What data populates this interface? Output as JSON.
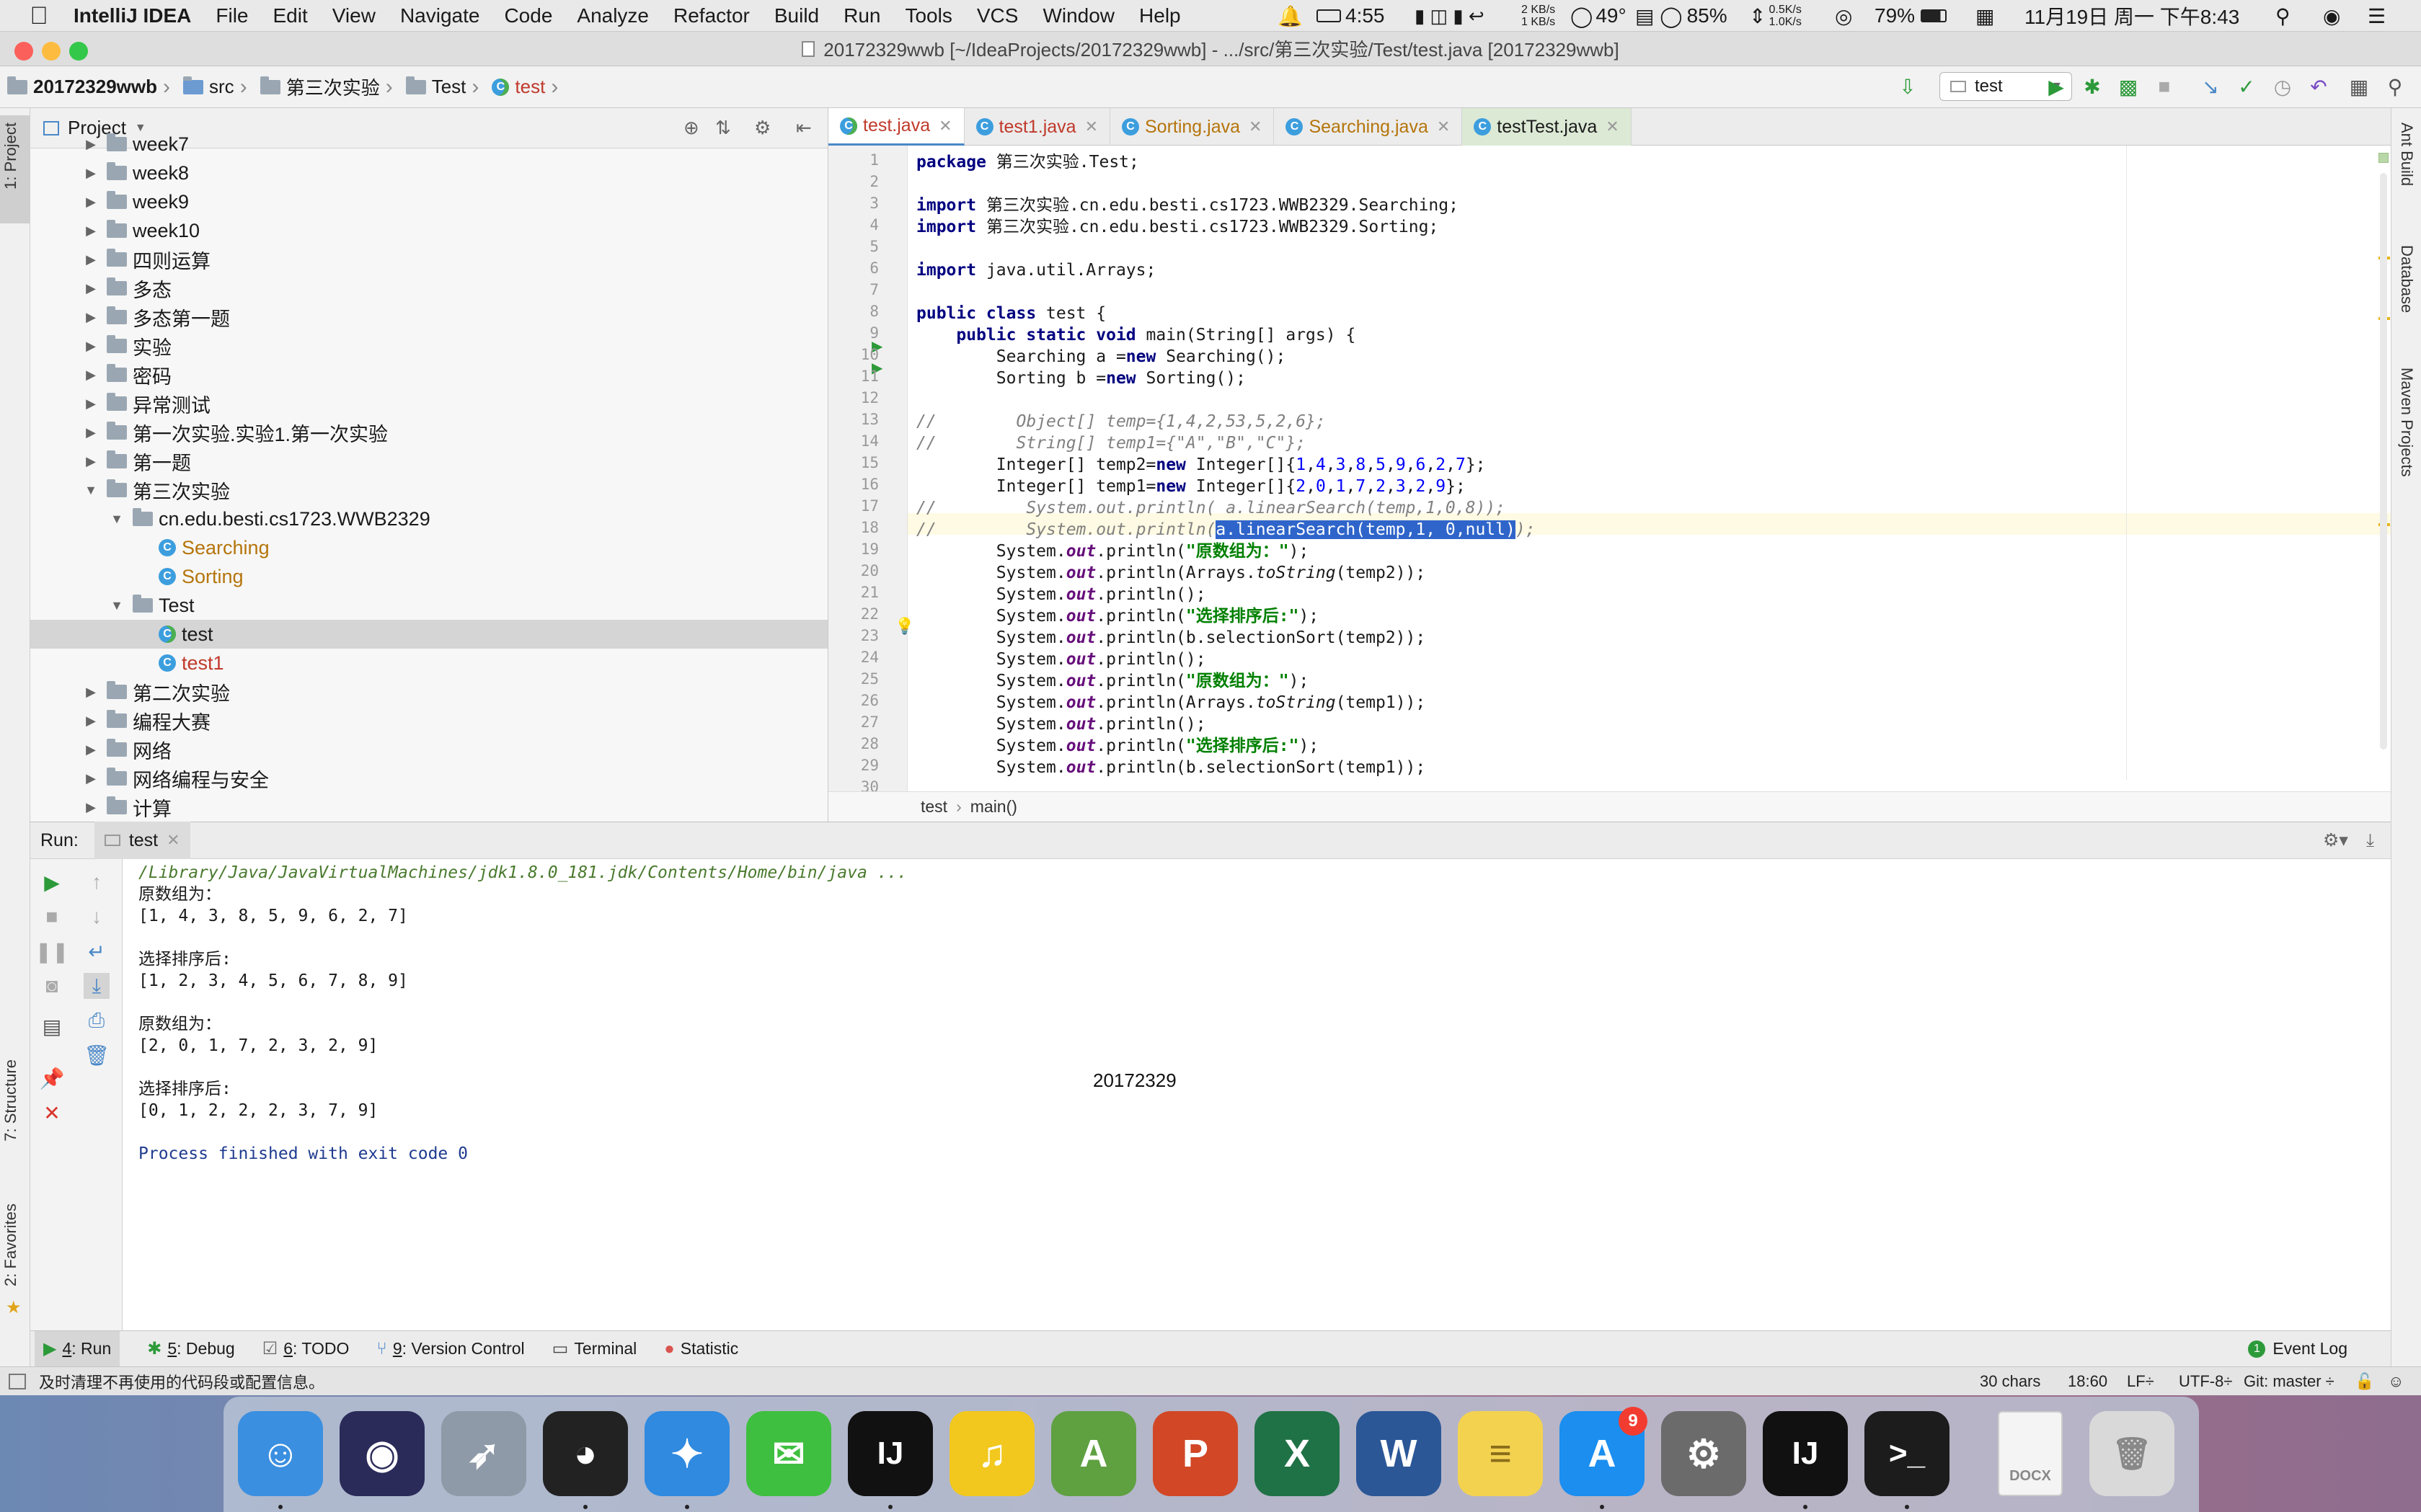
{
  "menubar": {
    "app": "IntelliJ IDEA",
    "items": [
      "File",
      "Edit",
      "View",
      "Navigate",
      "Code",
      "Analyze",
      "Refactor",
      "Build",
      "Run",
      "Tools",
      "VCS",
      "Window",
      "Help"
    ],
    "battery_time": "4:55",
    "net_up": "2 KB/s",
    "net_down": "1 KB/s",
    "temp": "49°",
    "cpu": "85%",
    "net2_up": "0.5K/s",
    "net2_down": "1.0K/s",
    "battery": "79%",
    "datetime": "11月19日 周一 下午8:43"
  },
  "window": {
    "title": "20172329wwb [~/IdeaProjects/20172329wwb] - .../src/第三次实验/Test/test.java [20172329wwb]"
  },
  "navbar": {
    "crumbs": [
      "20172329wwb",
      "src",
      "第三次实验",
      "Test",
      "test"
    ],
    "run_config": "test"
  },
  "left_strip": {
    "project_tab": "1: Project",
    "structure_tab": "7: Structure",
    "favorites_tab": "2: Favorites"
  },
  "right_strip": {
    "ant": "Ant Build",
    "database": "Database",
    "maven": "Maven Projects"
  },
  "project": {
    "header": "Project",
    "rows": [
      {
        "label": "week7",
        "indent": 1,
        "type": "folder",
        "arrow": "▶"
      },
      {
        "label": "week8",
        "indent": 1,
        "type": "folder",
        "arrow": "▶"
      },
      {
        "label": "week9",
        "indent": 1,
        "type": "folder",
        "arrow": "▶"
      },
      {
        "label": "week10",
        "indent": 1,
        "type": "folder",
        "arrow": "▶"
      },
      {
        "label": "四则运算",
        "indent": 1,
        "type": "folder",
        "arrow": "▶"
      },
      {
        "label": "多态",
        "indent": 1,
        "type": "folder",
        "arrow": "▶"
      },
      {
        "label": "多态第一题",
        "indent": 1,
        "type": "folder",
        "arrow": "▶"
      },
      {
        "label": "实验",
        "indent": 1,
        "type": "folder",
        "arrow": "▶"
      },
      {
        "label": "密码",
        "indent": 1,
        "type": "folder",
        "arrow": "▶"
      },
      {
        "label": "异常测试",
        "indent": 1,
        "type": "folder",
        "arrow": "▶"
      },
      {
        "label": "第一次实验.实验1.第一次实验",
        "indent": 1,
        "type": "folder",
        "arrow": "▶"
      },
      {
        "label": "第一题",
        "indent": 1,
        "type": "folder",
        "arrow": "▶"
      },
      {
        "label": "第三次实验",
        "indent": 1,
        "type": "folder",
        "arrow": "▼"
      },
      {
        "label": "cn.edu.besti.cs1723.WWB2329",
        "indent": 2,
        "type": "folder",
        "arrow": "▼"
      },
      {
        "label": "Searching",
        "indent": 3,
        "type": "class-mod",
        "arrow": ""
      },
      {
        "label": "Sorting",
        "indent": 3,
        "type": "class-mod",
        "arrow": ""
      },
      {
        "label": "Test",
        "indent": 2,
        "type": "folder",
        "arrow": "▼"
      },
      {
        "label": "test",
        "indent": 3,
        "type": "class-test",
        "arrow": "",
        "selected": true
      },
      {
        "label": "test1",
        "indent": 3,
        "type": "class-err",
        "arrow": ""
      },
      {
        "label": "第二次实验",
        "indent": 1,
        "type": "folder",
        "arrow": "▶"
      },
      {
        "label": "编程大赛",
        "indent": 1,
        "type": "folder",
        "arrow": "▶"
      },
      {
        "label": "网络",
        "indent": 1,
        "type": "folder",
        "arrow": "▶"
      },
      {
        "label": "网络编程与安全",
        "indent": 1,
        "type": "folder",
        "arrow": "▶"
      },
      {
        "label": "计算",
        "indent": 1,
        "type": "folder",
        "arrow": "▶"
      }
    ]
  },
  "editor": {
    "tabs": [
      {
        "label": "test.java",
        "active": true
      },
      {
        "label": "test1.java"
      },
      {
        "label": "Sorting.java",
        "mod": true
      },
      {
        "label": "Searching.java",
        "mod": true
      },
      {
        "label": "testTest.java",
        "testt": true
      }
    ],
    "lines": [
      [
        [
          "kw",
          "package "
        ],
        [
          "",
          "第三次实验.Test;"
        ]
      ],
      [],
      [
        [
          "kw",
          "import "
        ],
        [
          "",
          "第三次实验.cn.edu.besti.cs1723.WWB2329.Searching;"
        ]
      ],
      [
        [
          "kw",
          "import "
        ],
        [
          "",
          "第三次实验.cn.edu.besti.cs1723.WWB2329.Sorting;"
        ]
      ],
      [],
      [
        [
          "kw",
          "import "
        ],
        [
          "",
          "java.util.Arrays;"
        ]
      ],
      [],
      [
        [
          "kw",
          "public class "
        ],
        [
          "",
          "test {"
        ]
      ],
      [
        [
          "",
          "    "
        ],
        [
          "kw",
          "public static void "
        ],
        [
          "",
          "main(String[] args) {"
        ]
      ],
      [
        [
          "",
          "        Searching a ="
        ],
        [
          "kw",
          "new "
        ],
        [
          "",
          "Searching();"
        ]
      ],
      [
        [
          "",
          "        Sorting b ="
        ],
        [
          "kw",
          "new "
        ],
        [
          "",
          "Sorting();"
        ]
      ],
      [],
      [
        [
          "cmt",
          "//        Object[] temp={1,4,2,53,5,2,6};"
        ]
      ],
      [
        [
          "cmt",
          "//        String[] temp1={\"A\",\"B\",\"C\"};"
        ]
      ],
      [
        [
          "",
          "        Integer[] temp2="
        ],
        [
          "kw",
          "new "
        ],
        [
          "",
          "Integer[]{"
        ],
        [
          "num",
          "1"
        ],
        [
          "",
          ","
        ],
        [
          "num",
          "4"
        ],
        [
          "",
          ","
        ],
        [
          "num",
          "3"
        ],
        [
          "",
          ","
        ],
        [
          "num",
          "8"
        ],
        [
          "",
          ","
        ],
        [
          "num",
          "5"
        ],
        [
          "",
          ","
        ],
        [
          "num",
          "9"
        ],
        [
          "",
          ","
        ],
        [
          "num",
          "6"
        ],
        [
          "",
          ","
        ],
        [
          "num",
          "2"
        ],
        [
          "",
          ","
        ],
        [
          "num",
          "7"
        ],
        [
          "",
          "};"
        ]
      ],
      [
        [
          "",
          "        Integer[] temp1="
        ],
        [
          "kw",
          "new "
        ],
        [
          "",
          "Integer[]{"
        ],
        [
          "num",
          "2"
        ],
        [
          "",
          ","
        ],
        [
          "num",
          "0"
        ],
        [
          "",
          ","
        ],
        [
          "num",
          "1"
        ],
        [
          "",
          ","
        ],
        [
          "num",
          "7"
        ],
        [
          "",
          ","
        ],
        [
          "num",
          "2"
        ],
        [
          "",
          ","
        ],
        [
          "num",
          "3"
        ],
        [
          "",
          ","
        ],
        [
          "num",
          "2"
        ],
        [
          "",
          ","
        ],
        [
          "num",
          "9"
        ],
        [
          "",
          "};"
        ]
      ],
      [
        [
          "cmt",
          "//         System.out.println( a.linearSearch(temp,1,0,8));"
        ]
      ],
      [
        [
          "cmt",
          "//         System.out.println("
        ],
        [
          "hl",
          "a.linearSearch(temp,1, 0,null)"
        ],
        [
          "cmt",
          ");"
        ]
      ],
      [
        [
          "",
          "        System."
        ],
        [
          "fld",
          "out"
        ],
        [
          "",
          ".println("
        ],
        [
          "str",
          "\"原数组为：\""
        ],
        [
          "",
          ");"
        ]
      ],
      [
        [
          "",
          "        System."
        ],
        [
          "fld",
          "out"
        ],
        [
          "",
          ".println(Arrays."
        ],
        [
          "st",
          "toString"
        ],
        [
          "",
          "(temp2));"
        ]
      ],
      [
        [
          "",
          "        System."
        ],
        [
          "fld",
          "out"
        ],
        [
          "",
          ".println();"
        ]
      ],
      [
        [
          "",
          "        System."
        ],
        [
          "fld",
          "out"
        ],
        [
          "",
          ".println("
        ],
        [
          "str",
          "\"选择排序后:\""
        ],
        [
          "",
          ");"
        ]
      ],
      [
        [
          "",
          "        System."
        ],
        [
          "fld",
          "out"
        ],
        [
          "",
          ".println(b.selectionSort(temp2));"
        ]
      ],
      [
        [
          "",
          "        System."
        ],
        [
          "fld",
          "out"
        ],
        [
          "",
          ".println();"
        ]
      ],
      [
        [
          "",
          "        System."
        ],
        [
          "fld",
          "out"
        ],
        [
          "",
          ".println("
        ],
        [
          "str",
          "\"原数组为：\""
        ],
        [
          "",
          ");"
        ]
      ],
      [
        [
          "",
          "        System."
        ],
        [
          "fld",
          "out"
        ],
        [
          "",
          ".println(Arrays."
        ],
        [
          "st",
          "toString"
        ],
        [
          "",
          "(temp1));"
        ]
      ],
      [
        [
          "",
          "        System."
        ],
        [
          "fld",
          "out"
        ],
        [
          "",
          ".println();"
        ]
      ],
      [
        [
          "",
          "        System."
        ],
        [
          "fld",
          "out"
        ],
        [
          "",
          ".println("
        ],
        [
          "str",
          "\"选择排序后:\""
        ],
        [
          "",
          ");"
        ]
      ],
      [
        [
          "",
          "        System."
        ],
        [
          "fld",
          "out"
        ],
        [
          "",
          ".println(b.selectionSort(temp1));"
        ]
      ],
      []
    ],
    "line_numbers": [
      "1",
      "2",
      "3",
      "4",
      "5",
      "6",
      "7",
      "8",
      "9",
      "10",
      "11",
      "12",
      "13",
      "14",
      "15",
      "16",
      "17",
      "18",
      "19",
      "20",
      "21",
      "22",
      "23",
      "24",
      "25",
      "26",
      "27",
      "28",
      "29",
      "30"
    ],
    "breadcrumb": {
      "cls": "test",
      "method": "main()"
    }
  },
  "run": {
    "label": "Run:",
    "tab": "test",
    "console": [
      {
        "text": "/Library/Java/JavaVirtualMachines/jdk1.8.0_181.jdk/Contents/Home/bin/java ...",
        "color": "#4a7a2e",
        "italic": true
      },
      {
        "text": "原数组为："
      },
      {
        "text": "[1, 4, 3, 8, 5, 9, 6, 2, 7]"
      },
      {
        "text": ""
      },
      {
        "text": "选择排序后:"
      },
      {
        "text": "[1, 2, 3, 4, 5, 6, 7, 8, 9]"
      },
      {
        "text": ""
      },
      {
        "text": "原数组为："
      },
      {
        "text": "[2, 0, 1, 7, 2, 3, 2, 9]"
      },
      {
        "text": ""
      },
      {
        "text": "选择排序后:"
      },
      {
        "text": "[0, 1, 2, 2, 2, 3, 7, 9]"
      },
      {
        "text": ""
      },
      {
        "text": "Process finished with exit code 0",
        "color": "#1f3b8f"
      }
    ],
    "watermark": "20172329"
  },
  "bottom_tabs": [
    {
      "ul": "4",
      "label": ": Run",
      "icon": "▶",
      "color": "#2d9a3a"
    },
    {
      "ul": "5",
      "label": ": Debug",
      "icon": "✱",
      "color": "#2d9a3a"
    },
    {
      "ul": "6",
      "label": ": TODO",
      "icon": "☑",
      "color": "#666"
    },
    {
      "ul": "9",
      "label": ": Version Control",
      "icon": "⑂",
      "color": "#4a88c7"
    },
    {
      "ul": "",
      "label": "Terminal",
      "icon": "▭",
      "color": "#444"
    },
    {
      "ul": "",
      "label": "Statistic",
      "icon": "●",
      "color": "#d9534f"
    }
  ],
  "event_log": {
    "badge": "1",
    "label": "Event Log"
  },
  "status": {
    "message": "及时清理不再使用的代码段或配置信息。",
    "chars": "30 chars",
    "pos": "18:60",
    "lf": "LF÷",
    "enc": "UTF-8÷",
    "git": "Git: master ÷"
  },
  "dock": {
    "apps": [
      {
        "name": "Finder",
        "glyph": "☺",
        "bg": "#3b8fe0"
      },
      {
        "name": "Siri",
        "glyph": "◉",
        "bg": "#2b2b5a"
      },
      {
        "name": "Launchpad",
        "glyph": "➶",
        "bg": "#8f9aa8"
      },
      {
        "name": "QQ",
        "glyph": "◕",
        "bg": "#222"
      },
      {
        "name": "Safari",
        "glyph": "✦",
        "bg": "#2f8ae0"
      },
      {
        "name": "WeChat",
        "glyph": "✉",
        "bg": "#3fbf3f"
      },
      {
        "name": "IntelliJ IDEA",
        "glyph": "IJ",
        "bg": "#111"
      },
      {
        "name": "QQ Music",
        "glyph": "♫",
        "bg": "#f2c81e"
      },
      {
        "name": "Android Studio",
        "glyph": "A",
        "bg": "#5fa041"
      },
      {
        "name": "PowerPoint",
        "glyph": "P",
        "bg": "#d24726"
      },
      {
        "name": "Excel",
        "glyph": "X",
        "bg": "#1f7246"
      },
      {
        "name": "Word",
        "glyph": "W",
        "bg": "#2b5797"
      },
      {
        "name": "Notes",
        "glyph": "≡",
        "bg": "#f3d250"
      },
      {
        "name": "App Store",
        "glyph": "A",
        "bg": "#1b8ef0",
        "badge": "9"
      },
      {
        "name": "System Preferences",
        "glyph": "⚙",
        "bg": "#6b6b6b"
      },
      {
        "name": "IntelliJ IDEA 2",
        "glyph": "IJ",
        "bg": "#111"
      },
      {
        "name": "Terminal",
        "glyph": ">_",
        "bg": "#1c1c1c"
      },
      {
        "name": "Document",
        "glyph": "DOCX",
        "bg": "#f4f4f4"
      },
      {
        "name": "Trash",
        "glyph": "🗑",
        "bg": "#d9d9d9"
      }
    ]
  }
}
